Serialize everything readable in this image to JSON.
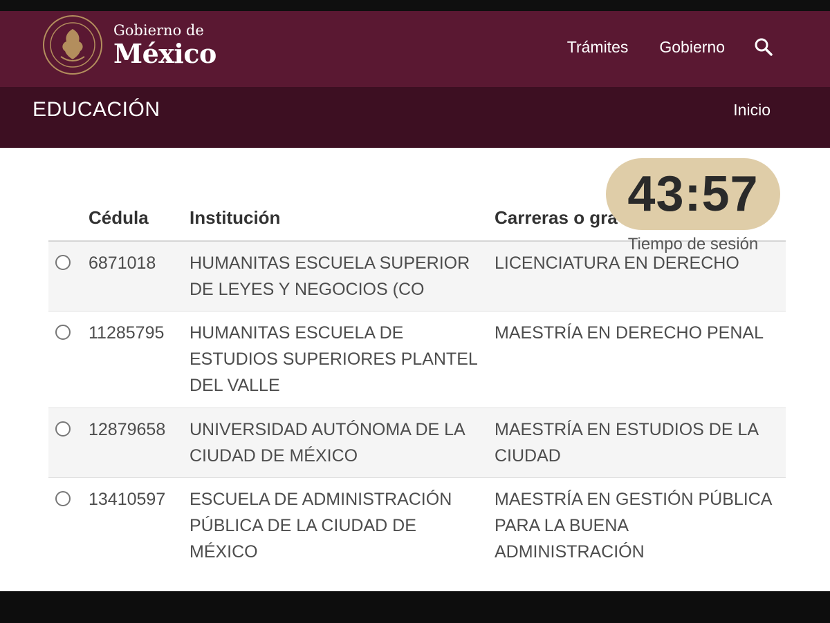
{
  "header": {
    "logo_small": "Gobierno de",
    "logo_big": "México",
    "nav": [
      "Trámites",
      "Gobierno"
    ],
    "search_icon": "search-icon"
  },
  "subheader": {
    "title": "EDUCACIÓN",
    "link": "Inicio"
  },
  "timer": {
    "value": "43:57",
    "label": "Tiempo de sesión"
  },
  "table": {
    "headers": [
      "Cédula",
      "Institución",
      "Carreras o gra"
    ],
    "rows": [
      {
        "cedula": "6871018",
        "institucion": "HUMANITAS ESCUELA SUPERIOR DE LEYES Y NEGOCIOS (CO",
        "carrera": "LICENCIATURA EN DERECHO"
      },
      {
        "cedula": "11285795",
        "institucion": "HUMANITAS ESCUELA DE ESTUDIOS SUPERIORES PLANTEL DEL VALLE",
        "carrera": "MAESTRÍA EN DERECHO PENAL"
      },
      {
        "cedula": "12879658",
        "institucion": "UNIVERSIDAD AUTÓNOMA DE LA CIUDAD DE MÉXICO",
        "carrera": "MAESTRÍA EN ESTUDIOS DE LA CIUDAD"
      },
      {
        "cedula": "13410597",
        "institucion": "ESCUELA DE ADMINISTRACIÓN PÚBLICA DE LA CIUDAD DE MÉXICO",
        "carrera": "MAESTRÍA EN GESTIÓN PÚBLICA PARA LA BUENA ADMINISTRACIÓN"
      }
    ]
  },
  "colors": {
    "navbar": "#5a1832",
    "subnav": "#3d0f22",
    "timer_bg": "#dfcda8",
    "seal_gold": "#b38e5d"
  }
}
